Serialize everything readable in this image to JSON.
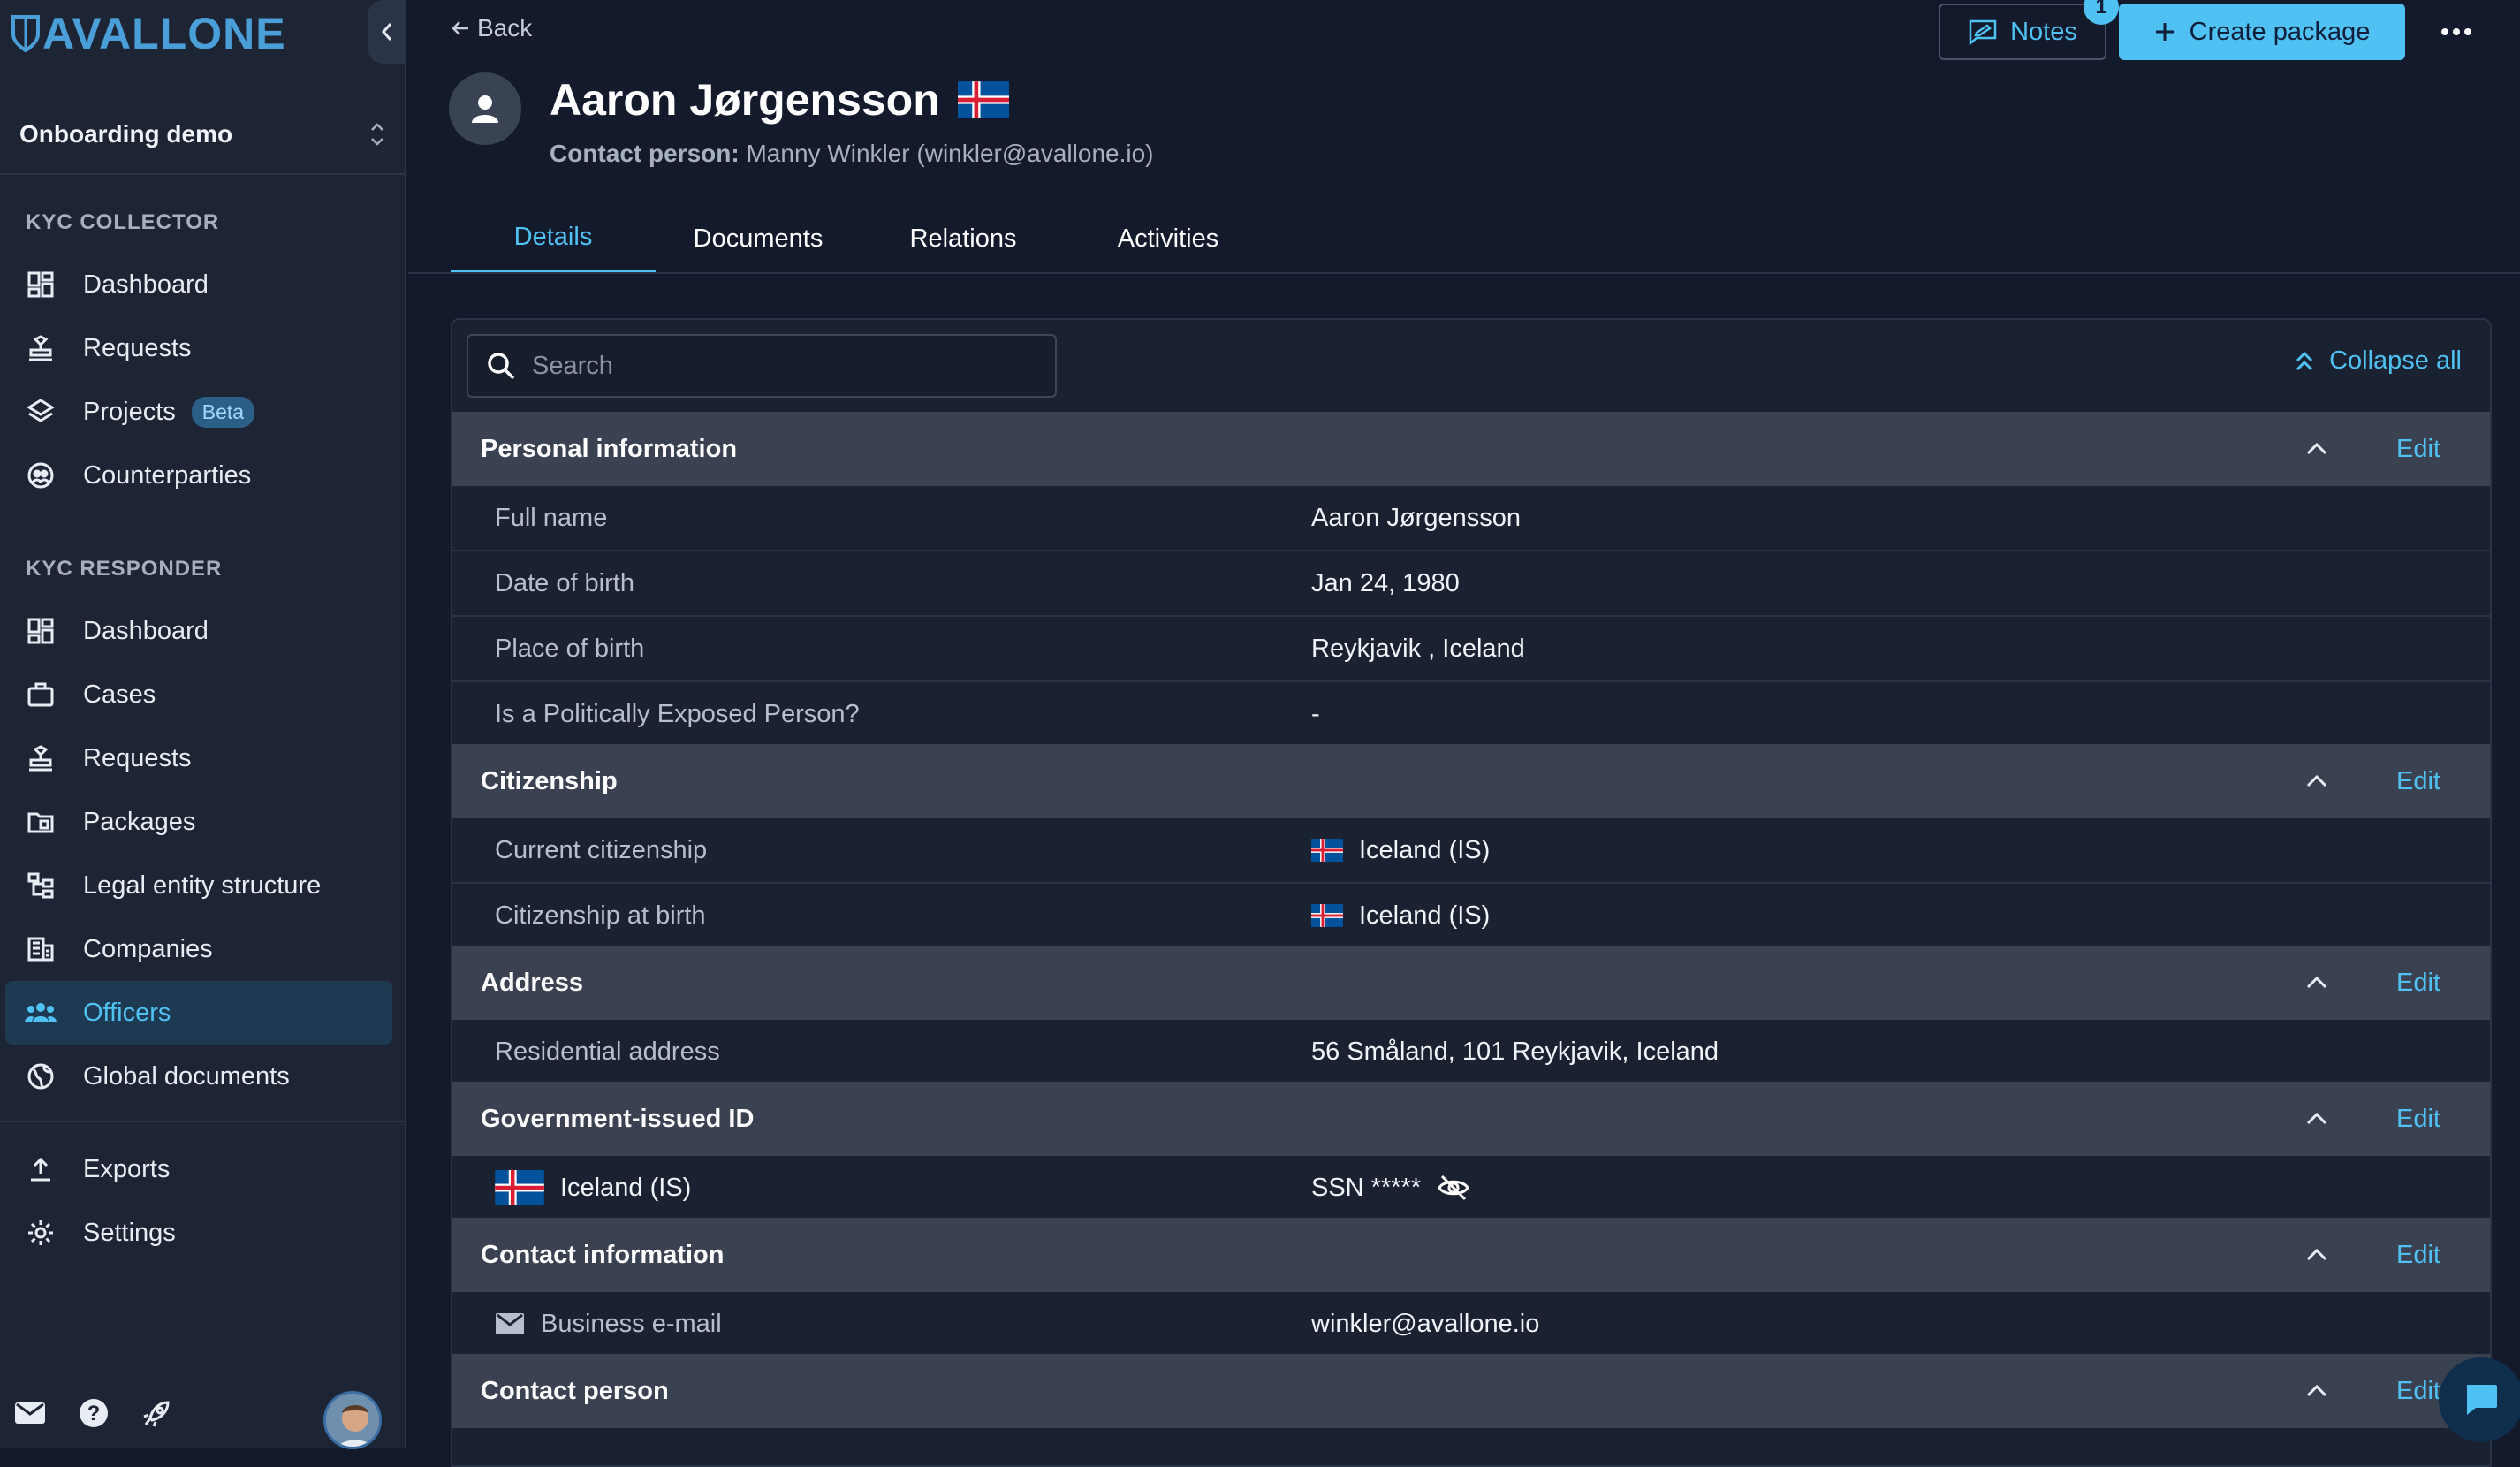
{
  "brand": {
    "name": "AVALLONE",
    "accent": "#4fc1f2",
    "logo_color": "#4b9fd8"
  },
  "org": {
    "name": "Onboarding demo"
  },
  "sidebar": {
    "collector_label": "KYC COLLECTOR",
    "collector_items": [
      {
        "label": "Dashboard",
        "icon": "dashboard-icon"
      },
      {
        "label": "Requests",
        "icon": "stamp-icon"
      },
      {
        "label": "Projects",
        "icon": "layers-icon",
        "badge": "Beta"
      },
      {
        "label": "Counterparties",
        "icon": "globe-people-icon"
      }
    ],
    "responder_label": "KYC RESPONDER",
    "responder_items": [
      {
        "label": "Dashboard",
        "icon": "dashboard-icon"
      },
      {
        "label": "Cases",
        "icon": "briefcase-icon"
      },
      {
        "label": "Requests",
        "icon": "stamp-icon"
      },
      {
        "label": "Packages",
        "icon": "folder-icon"
      },
      {
        "label": "Legal entity structure",
        "icon": "tree-icon"
      },
      {
        "label": "Companies",
        "icon": "building-icon"
      },
      {
        "label": "Officers",
        "icon": "people-icon",
        "active": true
      },
      {
        "label": "Global documents",
        "icon": "globe-icon"
      }
    ],
    "bottom_items": [
      {
        "label": "Exports",
        "icon": "upload-icon"
      },
      {
        "label": "Settings",
        "icon": "gear-icon"
      }
    ]
  },
  "header": {
    "back_label": "Back",
    "person_name": "Aaron Jørgensson",
    "flag": "Iceland",
    "contact_label": "Contact person:",
    "contact_value": "Manny Winkler (winkler@avallone.io)",
    "notes_label": "Notes",
    "notes_count": "1",
    "create_label": "Create package"
  },
  "tabs": [
    {
      "label": "Details",
      "active": true
    },
    {
      "label": "Documents"
    },
    {
      "label": "Relations"
    },
    {
      "label": "Activities"
    }
  ],
  "search": {
    "placeholder": "Search",
    "value": ""
  },
  "collapse_all_label": "Collapse all",
  "edit_label": "Edit",
  "sections": [
    {
      "title": "Personal information",
      "rows": [
        {
          "key": "Full name",
          "value": "Aaron Jørgensson"
        },
        {
          "key": "Date of birth",
          "value": "Jan 24, 1980"
        },
        {
          "key": "Place of birth",
          "value": "Reykjavik , Iceland"
        },
        {
          "key": "Is a Politically Exposed Person?",
          "value": "-"
        }
      ]
    },
    {
      "title": "Citizenship",
      "rows": [
        {
          "key": "Current citizenship",
          "value": "Iceland (IS)"
        },
        {
          "key": "Citizenship at birth",
          "value": "Iceland (IS)"
        }
      ]
    },
    {
      "title": "Address",
      "rows": [
        {
          "key": "Residential address",
          "value": "56 Småland, 101 Reykjavik, Iceland"
        }
      ]
    },
    {
      "title": "Government-issued ID",
      "rows": [
        {
          "key": "Iceland (IS)",
          "value": "SSN *****"
        }
      ]
    },
    {
      "title": "Contact information",
      "rows": [
        {
          "key": "Business e-mail",
          "value": "winkler@avallone.io"
        }
      ]
    },
    {
      "title": "Contact person",
      "rows": []
    }
  ]
}
